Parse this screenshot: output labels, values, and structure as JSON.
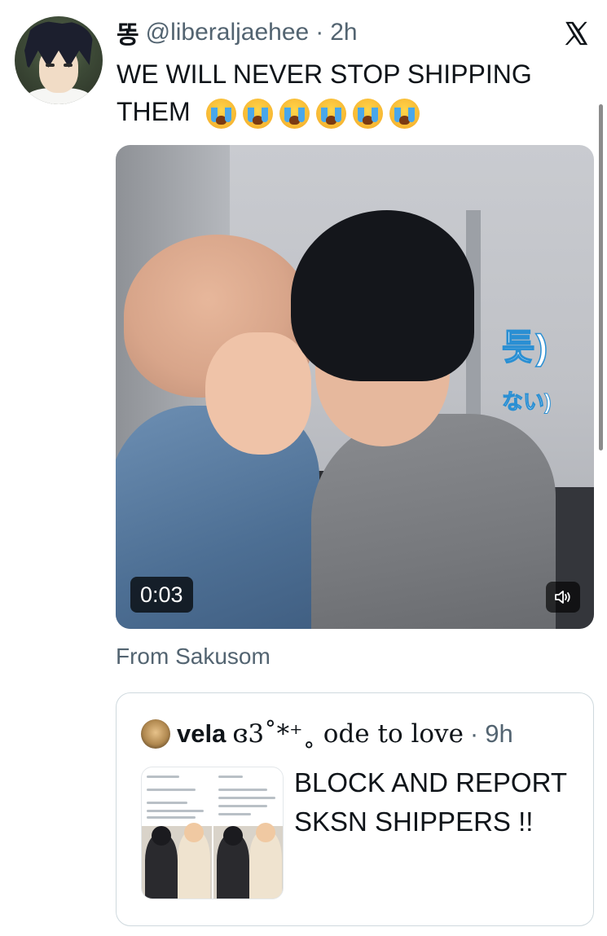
{
  "tweet": {
    "display_name": "똥",
    "handle": "@liberaljaehee",
    "separator": "·",
    "time": "2h",
    "text": "WE WILL NEVER STOP SHIPPING THEM",
    "emojis": [
      "loudly-crying-face",
      "loudly-crying-face",
      "loudly-crying-face",
      "loudly-crying-face",
      "loudly-crying-face",
      "loudly-crying-face"
    ]
  },
  "video": {
    "caption_korean": "틋)",
    "caption_japanese": "ない)",
    "duration": "0:03"
  },
  "source": "From Sakusom",
  "quote": {
    "name": "vela",
    "handle": "ɞ3˚*⁺˳ ode to love",
    "separator": "·",
    "time": "9h",
    "text": "BLOCK AND REPORT SKSN SHIPPERS !!"
  },
  "icons": {
    "logo": "x-logo-icon",
    "sound": "speaker-icon"
  },
  "colors": {
    "text_primary": "#0f1419",
    "text_secondary": "#536471",
    "border": "#cfd9de",
    "caption_outline": "#2a8fd3"
  }
}
